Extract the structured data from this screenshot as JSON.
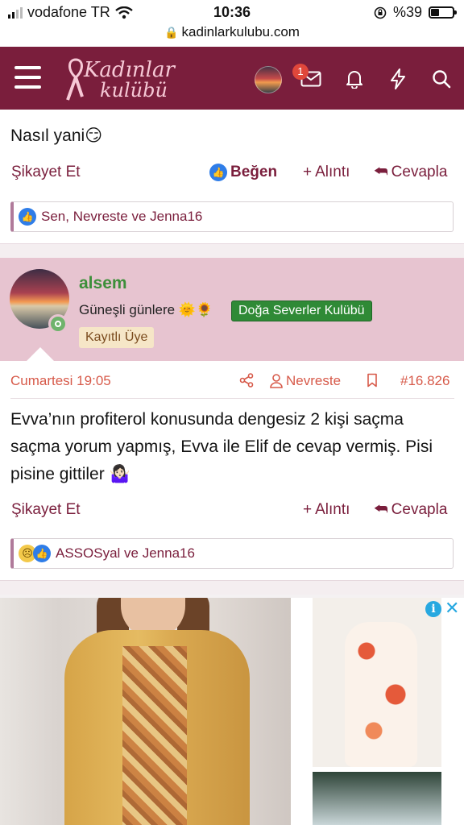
{
  "status": {
    "carrier": "vodafone TR",
    "time": "10:36",
    "battery": "%39",
    "battery_level": 0.39
  },
  "browser": {
    "url": "kadinlarkulubu.com"
  },
  "nav": {
    "logo_line1": "Kadınlar",
    "logo_line2": "kulübü",
    "notification_count": "1"
  },
  "post1": {
    "text": "Nasıl yani😏",
    "actions": {
      "report": "Şikayet Et",
      "like": "Beğen",
      "quote": "Alıntı",
      "reply": "Cevapla"
    },
    "reactions": "Sen, Nevreste ve Jenna16"
  },
  "post2": {
    "user": {
      "name": "alsem",
      "title": "Güneşli günlere 🌞🌻",
      "badge": "Doğa Severler Kulübü",
      "role": "Kayıtlı Üye"
    },
    "meta": {
      "date": "Cumartesi 19:05",
      "mention": "Nevreste",
      "number": "#16.826"
    },
    "text": "Evva’nın profiterol konusunda dengesiz 2 kişi saçma saçma yorum yapmış, Evva ile Elif de cevap vermiş. Pisi pisine gittiler 🤷🏻‍♀️",
    "actions": {
      "report": "Şikayet Et",
      "quote": "Alıntı",
      "reply": "Cevapla"
    },
    "reactions": "ASSOSyal ve Jenna16"
  },
  "ad": {
    "info": "i",
    "close": "✕"
  },
  "colors": {
    "brand": "#7a1e3c",
    "accent_orange": "#d75a4a",
    "username_green": "#3d8f3a",
    "like_blue": "#2f7de8"
  }
}
